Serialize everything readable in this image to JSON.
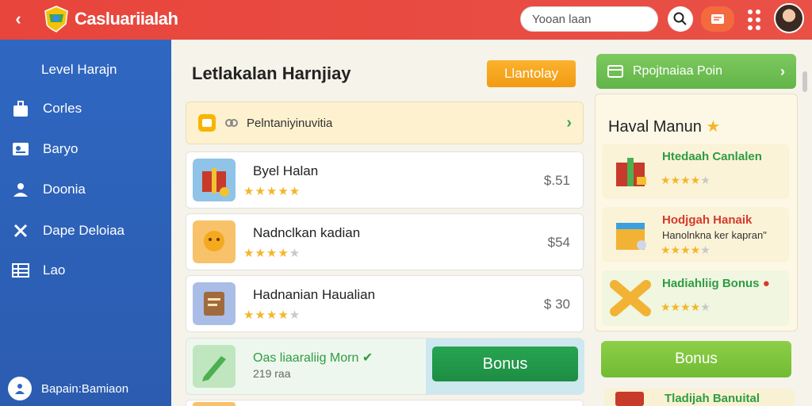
{
  "app": {
    "title": "Casluariialah",
    "search_placeholder": "Yooan laan"
  },
  "sidebar": {
    "heading": "Level Harajn",
    "items": [
      {
        "label": "Corles",
        "icon": "bag-icon"
      },
      {
        "label": "Baryo",
        "icon": "id-card-icon"
      },
      {
        "label": "Doonia",
        "icon": "person-icon"
      },
      {
        "label": "Dape Deloiaa",
        "icon": "close-icon"
      },
      {
        "label": "Lao",
        "icon": "table-icon"
      }
    ],
    "footer_label": "Bapain:Bamiaon"
  },
  "main": {
    "title": "Letlakalan Harnjiay",
    "primary_button": "Llantolay",
    "notice": "Pelntaniyinuvitia",
    "rows": [
      {
        "name": "Byel Halan",
        "rating": 5,
        "price": "$.51"
      },
      {
        "name": "Nadnclkan kadian",
        "rating": 4,
        "price": "$54"
      },
      {
        "name": "Hadnanian Haualian",
        "rating": 4,
        "price": "$ 30"
      }
    ],
    "bonus_row": {
      "name": "Oas liaaraliig Morn",
      "sub": "219 raa",
      "button": "Bonus"
    }
  },
  "right": {
    "top_button": "Rpojtnaiaa Poin",
    "title": "Haval Manun",
    "items": [
      {
        "name": "Htedaah Canlalen",
        "desc": "",
        "rating": 4
      },
      {
        "name": "Hodjgah Hanaik",
        "desc": "Hanolnkna ker kapran\"",
        "rating": 4
      },
      {
        "name": "Hadiahliig Bonus",
        "desc": "",
        "rating": 4
      }
    ],
    "bonus_button": "Bonus",
    "bottom_item": "Tladijah Banuital"
  },
  "colors": {
    "topbar": "#e8453c",
    "sidebar": "#2f67c1",
    "accent_orange": "#f29a13",
    "accent_green": "#1d8d43",
    "star": "#f3b62a"
  }
}
